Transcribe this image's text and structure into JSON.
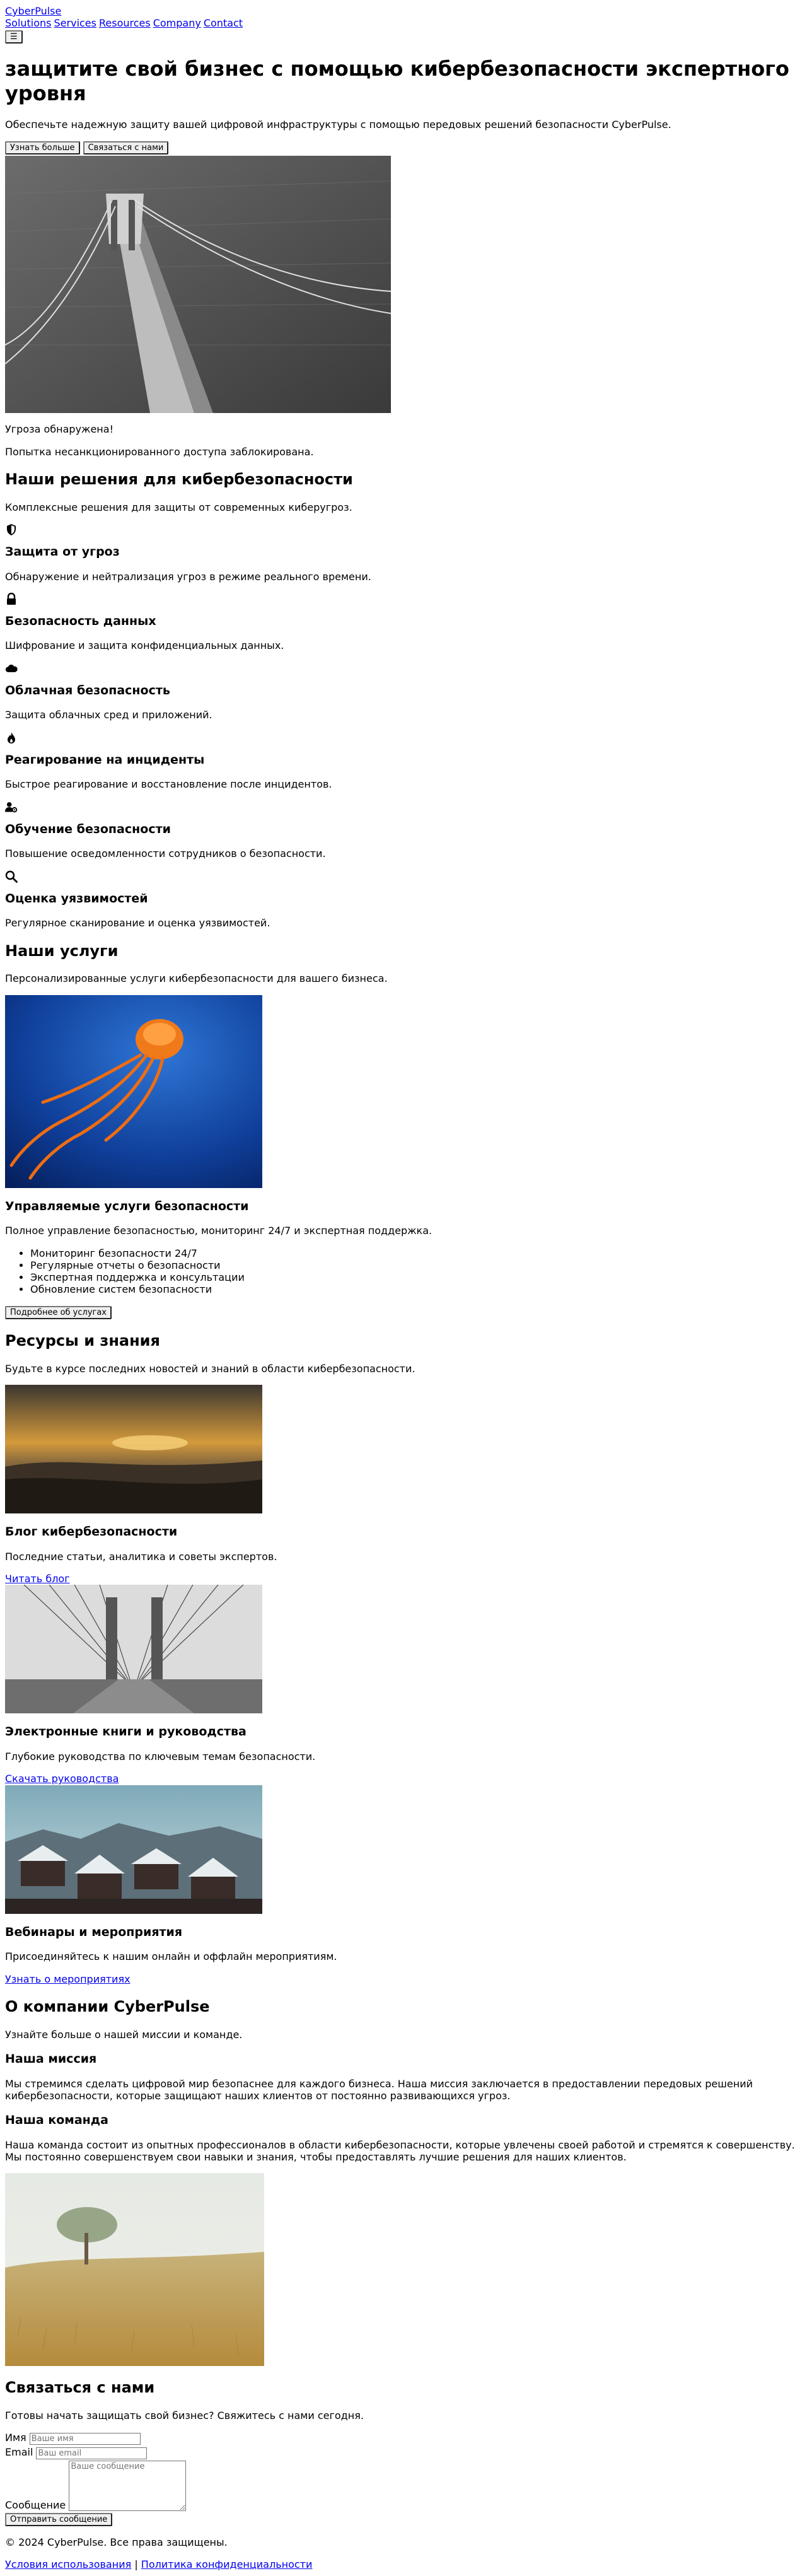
{
  "header": {
    "logo": "CyberPulse",
    "nav": [
      "Solutions",
      "Services",
      "Resources",
      "Company",
      "Contact"
    ],
    "menu_toggle": "☰"
  },
  "hero": {
    "title": "защитите свой бизнес с помощью кибербезопасности экспертного уровня",
    "subtitle": "Обеспечьте надежную защиту вашей цифровой инфраструктуры с помощью передовых решений безопасности CyberPulse.",
    "learn_more": "Узнать больше",
    "contact_us": "Связаться с нами",
    "alert_title": "Угроза обнаружена!",
    "alert_text": "Попытка несанкционированного доступа заблокирована."
  },
  "solutions": {
    "title": "Наши решения для кибербезопасности",
    "subtitle": "Комплексные решения для защиты от современных киберугроз.",
    "items": [
      {
        "icon": "shield-icon",
        "title": "Защита от угроз",
        "text": "Обнаружение и нейтрализация угроз в режиме реального времени."
      },
      {
        "icon": "lock-icon",
        "title": "Безопасность данных",
        "text": "Шифрование и защита конфиденциальных данных."
      },
      {
        "icon": "cloud-icon",
        "title": "Облачная безопасность",
        "text": "Защита облачных сред и приложений."
      },
      {
        "icon": "fire-icon",
        "title": "Реагирование на инциденты",
        "text": "Быстрое реагирование и восстановление после инцидентов."
      },
      {
        "icon": "user-gear-icon",
        "title": "Обучение безопасности",
        "text": "Повышение осведомленности сотрудников о безопасности."
      },
      {
        "icon": "search-icon",
        "title": "Оценка уязвимостей",
        "text": "Регулярное сканирование и оценка уязвимостей."
      }
    ]
  },
  "services": {
    "title": "Наши услуги",
    "subtitle": "Персонализированные услуги кибербезопасности для вашего бизнеса.",
    "item_title": "Управляемые услуги безопасности",
    "item_text": "Полное управление безопасностью, мониторинг 24/7 и экспертная поддержка.",
    "list": [
      "Мониторинг безопасности 24/7",
      "Регулярные отчеты о безопасности",
      "Экспертная поддержка и консультации",
      "Обновление систем безопасности"
    ],
    "button": "Подробнее об услугах"
  },
  "resources": {
    "title": "Ресурсы и знания",
    "subtitle": "Будьте в курсе последних новостей и знаний в области кибербезопасности.",
    "items": [
      {
        "title": "Блог кибербезопасности",
        "text": "Последние статьи, аналитика и советы экспертов.",
        "link": "Читать блог"
      },
      {
        "title": "Электронные книги и руководства",
        "text": "Глубокие руководства по ключевым темам безопасности.",
        "link": "Скачать руководства"
      },
      {
        "title": "Вебинары и мероприятия",
        "text": "Присоединяйтесь к нашим онлайн и оффлайн мероприятиям.",
        "link": "Узнать о мероприятиях"
      }
    ]
  },
  "company": {
    "title": "О компании CyberPulse",
    "subtitle": "Узнайте больше о нашей миссии и команде.",
    "mission_title": "Наша миссия",
    "mission_text": "Мы стремимся сделать цифровой мир безопаснее для каждого бизнеса. Наша миссия заключается в предоставлении передовых решений кибербезопасности, которые защищают наших клиентов от постоянно развивающихся угроз.",
    "team_title": "Наша команда",
    "team_text": "Наша команда состоит из опытных профессионалов в области кибербезопасности, которые увлечены своей работой и стремятся к совершенству. Мы постоянно совершенствуем свои навыки и знания, чтобы предоставлять лучшие решения для наших клиентов."
  },
  "contact": {
    "title": "Связаться с нами",
    "subtitle": "Готовы начать защищать свой бизнес? Свяжитесь с нами сегодня.",
    "name_label": "Имя",
    "name_placeholder": "Ваше имя",
    "email_label": "Email",
    "email_placeholder": "Ваш email",
    "message_label": "Сообщение",
    "message_placeholder": "Ваше сообщение",
    "submit": "Отправить сообщение"
  },
  "footer": {
    "copyright": "© 2024 CyberPulse. Все права защищены.",
    "terms": "Условия использования",
    "separator": "|",
    "privacy": "Политика конфиденциальности"
  }
}
